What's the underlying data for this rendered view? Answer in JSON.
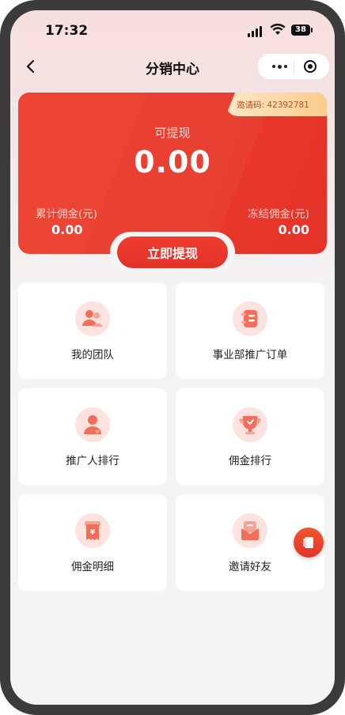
{
  "status_bar": {
    "time": "17:32",
    "battery": "38"
  },
  "navbar": {
    "title": "分销中心"
  },
  "card": {
    "invite_code": "邀请码: 42392781",
    "withdrawable_label": "可提现",
    "withdrawable_amount": "0.00",
    "cumulative_label": "累计佣金(元)",
    "cumulative_value": "0.00",
    "frozen_label": "冻结佣金(元)",
    "frozen_value": "0.00"
  },
  "withdraw_button": {
    "label": "立即提现"
  },
  "menu": [
    {
      "label": "我的团队",
      "icon": "team-icon"
    },
    {
      "label": "事业部推广订单",
      "icon": "order-icon"
    },
    {
      "label": "推广人排行",
      "icon": "promoter-rank-icon"
    },
    {
      "label": "佣金排行",
      "icon": "trophy-icon"
    },
    {
      "label": "佣金明细",
      "icon": "receipt-icon"
    },
    {
      "label": "邀请好友",
      "icon": "invite-icon"
    }
  ],
  "colors": {
    "accent": "#e8392b",
    "icon_bg": "#fde3e0",
    "page_bg": "#f4f4f4"
  }
}
